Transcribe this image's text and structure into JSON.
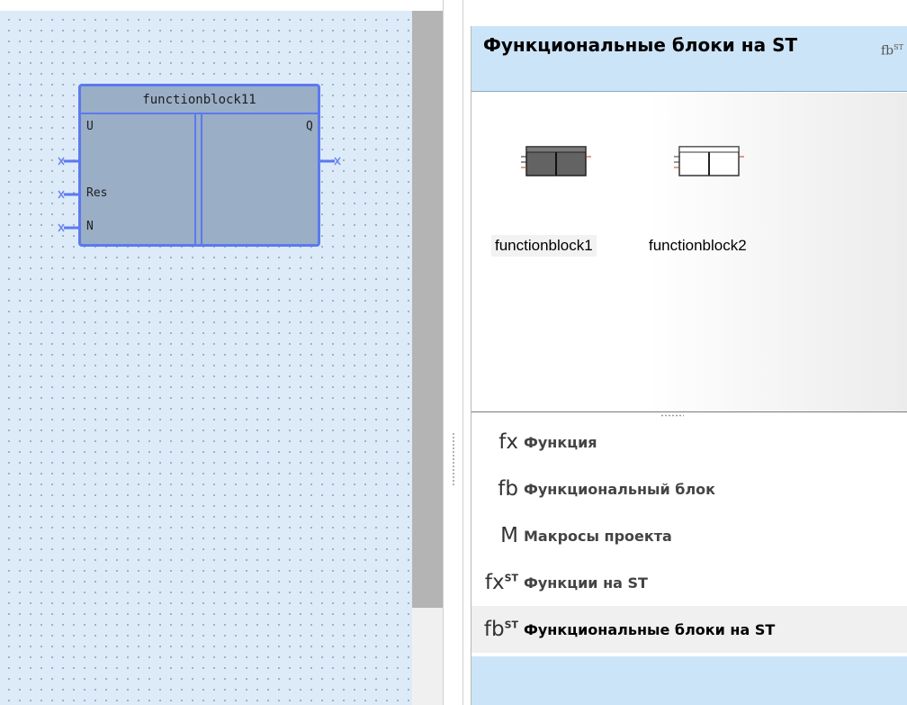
{
  "canvas": {
    "block": {
      "title": "functionblock11",
      "inputs": [
        "U",
        "Res",
        "N"
      ],
      "outputs": [
        "Q"
      ]
    }
  },
  "panel": {
    "title": "Функциональные блоки на ST",
    "title_icon": {
      "base": "fb",
      "sup": "ST",
      "icon": "fb-st-icon"
    },
    "blocks": [
      {
        "label": "functionblock1",
        "style": "dark"
      },
      {
        "label": "functionblock2",
        "style": "light"
      }
    ],
    "categories": [
      {
        "icon": {
          "base": "fx",
          "sup": ""
        },
        "label": "Функция"
      },
      {
        "icon": {
          "base": "fb",
          "sup": ""
        },
        "label": "Функциональный блок"
      },
      {
        "icon": {
          "base": "M",
          "sup": ""
        },
        "label": "Макросы проекта"
      },
      {
        "icon": {
          "base": "fx",
          "sup": "ST"
        },
        "label": "Функции на ST"
      },
      {
        "icon": {
          "base": "fb",
          "sup": "ST"
        },
        "label": "Функциональные блоки на ST",
        "selected": true
      }
    ]
  },
  "colors": {
    "canvas_bg": "#dcebf7",
    "block_border": "#5c79f0",
    "block_fill": "#9aaec6",
    "header_bg": "#cce4f7"
  }
}
